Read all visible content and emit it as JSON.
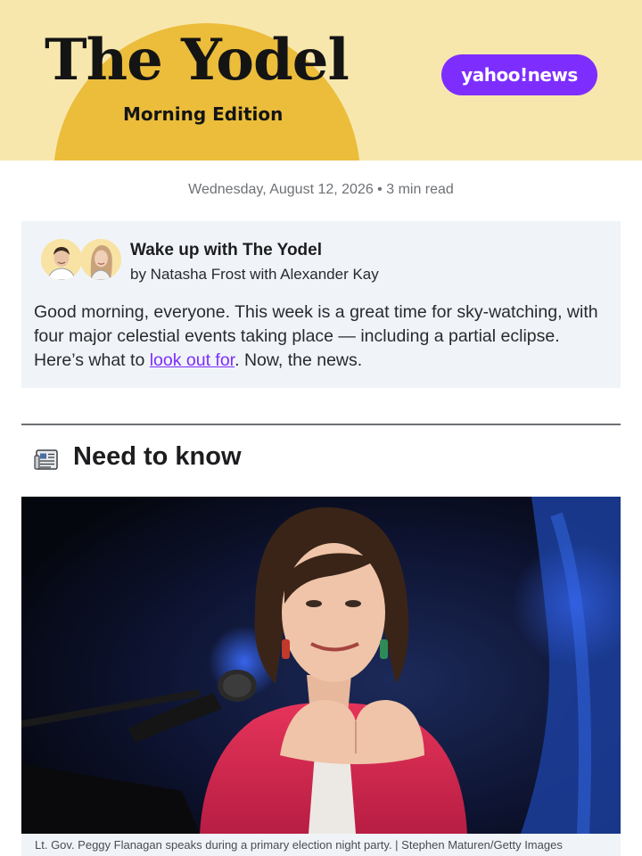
{
  "header": {
    "title": "The Yodel",
    "subtitle": "Morning Edition",
    "badge": "yahoo!news",
    "colors": {
      "background": "#f8e7ad",
      "sun": "#ebbd3b",
      "badge": "#7d2eff"
    }
  },
  "meta": {
    "dateline": "Wednesday, August 12, 2026 • 3 min read"
  },
  "intro": {
    "title": "Wake up with The Yodel",
    "byline": "by Natasha Frost with Alexander Kay",
    "body_before": "Good morning, everyone. This week is a great time for sky-watching, with four major celestial events taking place — including a partial eclipse. Here’s what to ",
    "link_text": "look out for",
    "body_after": ". Now, the news."
  },
  "section": {
    "icon": "newspaper-icon",
    "title": "Need to know"
  },
  "photo": {
    "caption": "Lt. Gov. Peggy Flanagan speaks during a primary election night party. | Stephen Maturen/Getty Images"
  }
}
